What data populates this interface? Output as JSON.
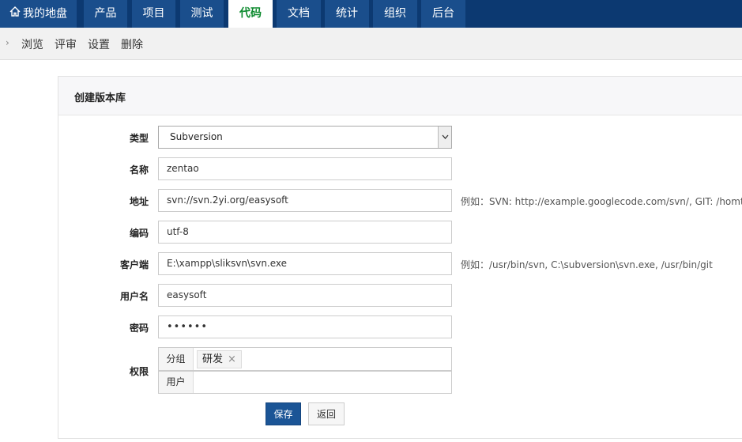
{
  "nav": {
    "items": [
      {
        "label": "我的地盘",
        "icon": "home-icon"
      },
      {
        "label": "产品"
      },
      {
        "label": "项目"
      },
      {
        "label": "测试"
      },
      {
        "label": "代码",
        "active": true
      },
      {
        "label": "文档"
      },
      {
        "label": "统计"
      },
      {
        "label": "组织"
      },
      {
        "label": "后台"
      }
    ]
  },
  "subnav": {
    "items": [
      "浏览",
      "评审",
      "设置",
      "删除"
    ]
  },
  "form": {
    "title": "创建版本库",
    "type_label": "类型",
    "type_value": "Subversion",
    "name_label": "名称",
    "name_value": "zentao",
    "path_label": "地址",
    "path_value": "svn://svn.2yi.org/easysoft",
    "path_hint": "例如：SVN: http://example.googlecode.com/svn/, GIT: /homt/test",
    "encoding_label": "编码",
    "encoding_value": "utf-8",
    "client_label": "客户端",
    "client_value": "E:\\xampp\\sliksvn\\svn.exe",
    "client_hint": "例如：/usr/bin/svn, C:\\subversion\\svn.exe, /usr/bin/git",
    "account_label": "用户名",
    "account_value": "easysoft",
    "password_label": "密码",
    "password_value": "••••••",
    "acl_label": "权限",
    "acl_group_label": "分组",
    "acl_group_chip": "研发",
    "acl_user_label": "用户",
    "acl_user_value": ""
  },
  "buttons": {
    "save": "保存",
    "back": "返回"
  },
  "colors": {
    "nav_bg": "#0c3971",
    "nav_item_bg": "#1a4e8c",
    "active_text": "#0c8a2e",
    "primary": "#1b5596"
  }
}
